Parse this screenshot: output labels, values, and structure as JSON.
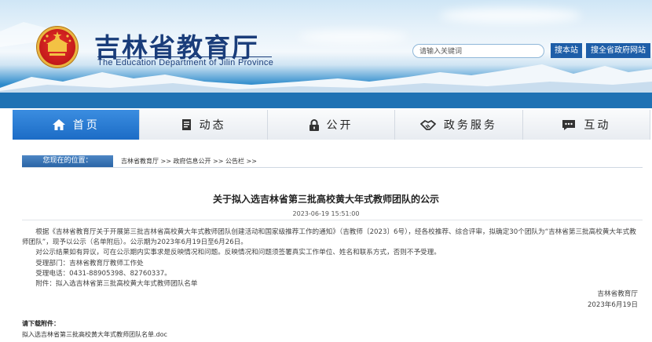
{
  "header": {
    "title": "吉林省教育厅",
    "subtitle": "The Education Department of Jilin Province",
    "search_placeholder": "请输入关键词",
    "search_site_btn": "搜本站",
    "search_all_btn": "搜全省政府网站"
  },
  "nav": {
    "items": [
      {
        "label": "首页",
        "icon": "home-icon",
        "active": true
      },
      {
        "label": "动态",
        "icon": "document-icon",
        "active": false
      },
      {
        "label": "公开",
        "icon": "lock-icon",
        "active": false
      },
      {
        "label": "政务服务",
        "icon": "handshake-icon",
        "active": false
      },
      {
        "label": "互动",
        "icon": "chat-icon",
        "active": false
      }
    ]
  },
  "breadcrumb": {
    "label": "您现在的位置：",
    "path": "吉林省教育厅 >> 政府信息公开 >> 公告栏 >>"
  },
  "article": {
    "title": "关于拟入选吉林省第三批高校黄大年式教师团队的公示",
    "date": "2023-06-19 15:51:00",
    "para1": "　　根据《吉林省教育厅关于开展第三批吉林省高校黄大年式教师团队创建活动和国家级推荐工作的通知》（吉教师〔2023〕6号），经各校推荐、综合评审，拟确定30个团队为“吉林省第三批高校黄大年式教师团队”，现予以公示（名单附后）。公示期为2023年6月19日至6月26日。",
    "para2": "　　对公示结果如有异议，可在公示期内实事求是反映情况和问题。反映情况和问题须签署真实工作单位、姓名和联系方式，否则不予受理。",
    "dept": "　　受理部门：吉林省教育厅教师工作处",
    "phone": "　　受理电话：0431-88905398、82760337。",
    "attachment": "　　附件：拟入选吉林省第三批高校黄大年式教师团队名单",
    "sign_org": "吉林省教育厅",
    "sign_date": "2023年6月19日",
    "download_title": "请下载附件：",
    "download_file": "拟入选吉林省第三批高校黄大年式教师团队名单.doc"
  },
  "colors": {
    "brand_blue": "#1a3d7a",
    "nav_active": "#2a7ad4",
    "button_blue": "#1e5ea8"
  }
}
